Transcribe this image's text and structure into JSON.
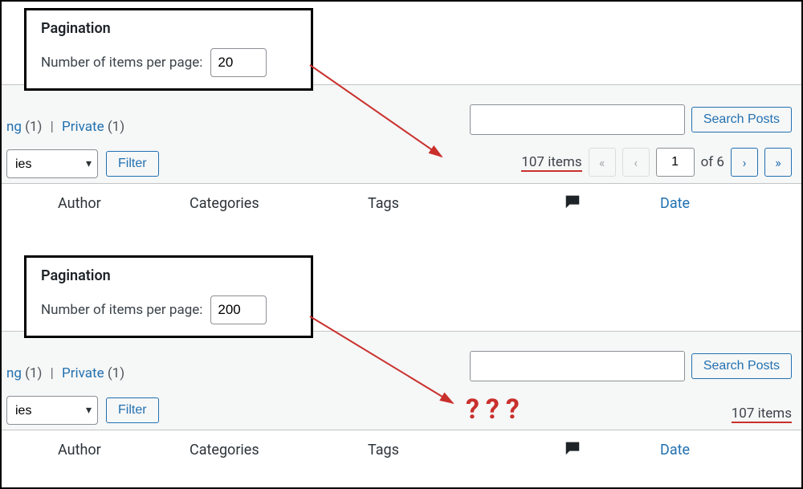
{
  "callout1": {
    "title": "Pagination",
    "label": "Number of items per page:",
    "value": "20"
  },
  "callout2": {
    "title": "Pagination",
    "label": "Number of items per page:",
    "value": "200"
  },
  "views": {
    "pending_label": "ng",
    "pending_count": "(1)",
    "private_label": "Private",
    "private_count": "(1)"
  },
  "filters": {
    "category_value": "ies",
    "filter_label": "Filter"
  },
  "search": {
    "button": "Search Posts"
  },
  "pagenav_top": {
    "total": "107 items",
    "page": "1",
    "of": "of 6"
  },
  "pagenav_bottom": {
    "total": "107 items"
  },
  "columns": {
    "author": "Author",
    "categories": "Categories",
    "tags": "Tags",
    "date": "Date"
  },
  "q": "???"
}
